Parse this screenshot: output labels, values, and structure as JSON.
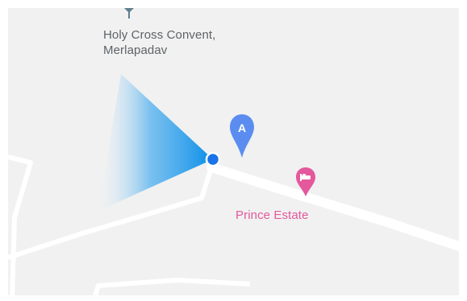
{
  "map": {
    "pois": [
      {
        "line1": "Holy Cross Convent,",
        "line2": "Merlapadav",
        "icon": "school-pin-icon",
        "color": "#5f7f8e"
      },
      {
        "label": "Prince Estate",
        "icon": "hotel-bed-icon",
        "color": "#e4589c"
      }
    ],
    "marker": {
      "letter": "A",
      "color": "#5b8df0"
    },
    "location": {
      "dot_color": "#1a73e8",
      "beam_color": "#0a8ee8"
    },
    "colors": {
      "land": "#f1f1f1",
      "road": "#ffffff"
    }
  }
}
